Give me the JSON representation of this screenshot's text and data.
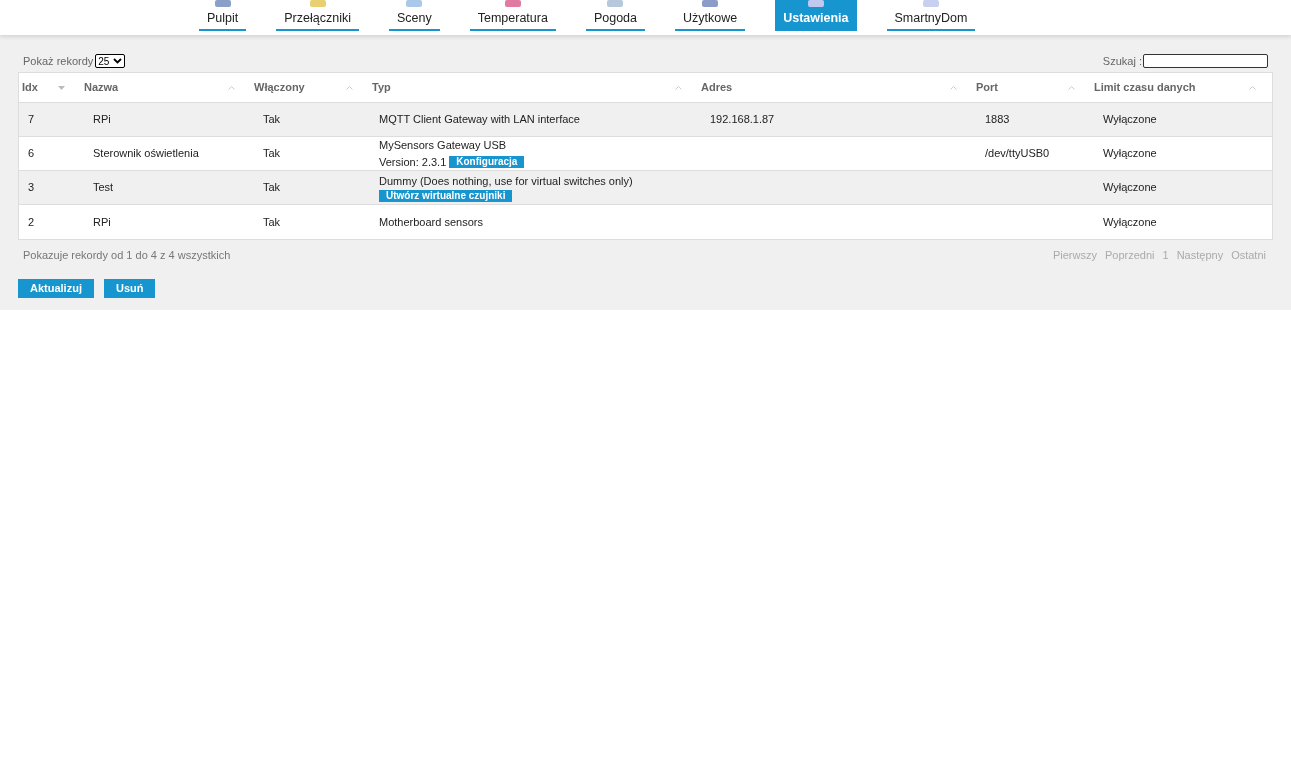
{
  "nav": [
    {
      "label": "Pulpit",
      "selected": false
    },
    {
      "label": "Przełączniki",
      "selected": false
    },
    {
      "label": "Sceny",
      "selected": false
    },
    {
      "label": "Temperatura",
      "selected": false
    },
    {
      "label": "Pogoda",
      "selected": false
    },
    {
      "label": "Użytkowe",
      "selected": false
    },
    {
      "label": "Ustawienia",
      "selected": true
    },
    {
      "label": "SmartnyDom",
      "selected": false
    }
  ],
  "length": {
    "label": "Pokaż rekordy",
    "value": "25"
  },
  "search": {
    "label": "Szukaj :"
  },
  "table": {
    "columns": [
      {
        "label": "Idx",
        "sorted": true
      },
      {
        "label": "Nazwa",
        "sorted": false
      },
      {
        "label": "Włączony",
        "sorted": false
      },
      {
        "label": "Typ",
        "sorted": false
      },
      {
        "label": "Adres",
        "sorted": false
      },
      {
        "label": "Port",
        "sorted": false
      },
      {
        "label": "Limit czasu danych",
        "sorted": false
      }
    ],
    "rows": [
      {
        "idx": "7",
        "name": "RPi",
        "enabled": "Tak",
        "type": "MQTT Client Gateway with LAN interface",
        "address": "192.168.1.87",
        "port": "1883",
        "timeout": "Wyłączone"
      },
      {
        "idx": "6",
        "name": "Sterownik oświetlenia",
        "enabled": "Tak",
        "type": "MySensors Gateway USB",
        "version": "Version: 2.3.1",
        "button": "Konfiguracja",
        "port": "/dev/ttyUSB0",
        "timeout": "Wyłączone"
      },
      {
        "idx": "3",
        "name": "Test",
        "enabled": "Tak",
        "type": "Dummy (Does nothing, use for virtual switches only)",
        "button": "Utwórz wirtualne czujniki",
        "timeout": "Wyłączone"
      },
      {
        "idx": "2",
        "name": "RPi",
        "enabled": "Tak",
        "type": "Motherboard sensors",
        "timeout": "Wyłączone"
      }
    ]
  },
  "info": "Pokazuje rekordy od 1 do 4 z 4 wszystkich",
  "pagination": [
    "Pierwszy",
    "Poprzedni",
    "1",
    "Następny",
    "Ostatni"
  ],
  "buttons": [
    "Aktualizuj",
    "Usuń"
  ]
}
